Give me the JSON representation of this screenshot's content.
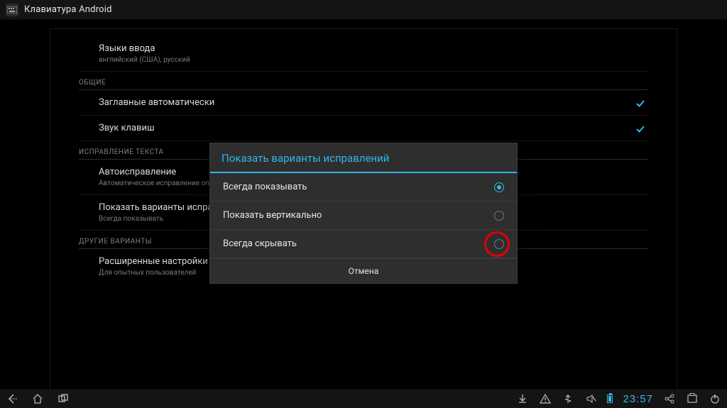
{
  "appbar": {
    "title": "Клавиатура Android"
  },
  "settings": {
    "row_input_languages": {
      "title": "Языки ввода",
      "sub": "английский (США), русский"
    },
    "section_general": "ОБЩИЕ",
    "row_auto_caps": {
      "title": "Заглавные автоматически"
    },
    "row_key_sound": {
      "title": "Звук клавиш"
    },
    "section_text_correction": "ИСПРАВЛЕНИЕ ТЕКСТА",
    "row_autocorrect": {
      "title": "Автоисправление",
      "sub": "Автоматическое исправление опечаток"
    },
    "row_show_corrections": {
      "title": "Показать варианты исправлений",
      "sub": "Всегда показывать"
    },
    "section_other": "ДРУГИЕ ВАРИАНТЫ",
    "row_advanced": {
      "title": "Расширенные настройки",
      "sub": "Для опытных пользователей"
    }
  },
  "dialog": {
    "title": "Показать варианты исправлений",
    "options": [
      {
        "label": "Всегда показывать",
        "selected": true
      },
      {
        "label": "Показать вертикально",
        "selected": false
      },
      {
        "label": "Всегда скрывать",
        "selected": false,
        "marked": true
      }
    ],
    "cancel": "Отмена"
  },
  "statusbar": {
    "time": "23:57"
  }
}
